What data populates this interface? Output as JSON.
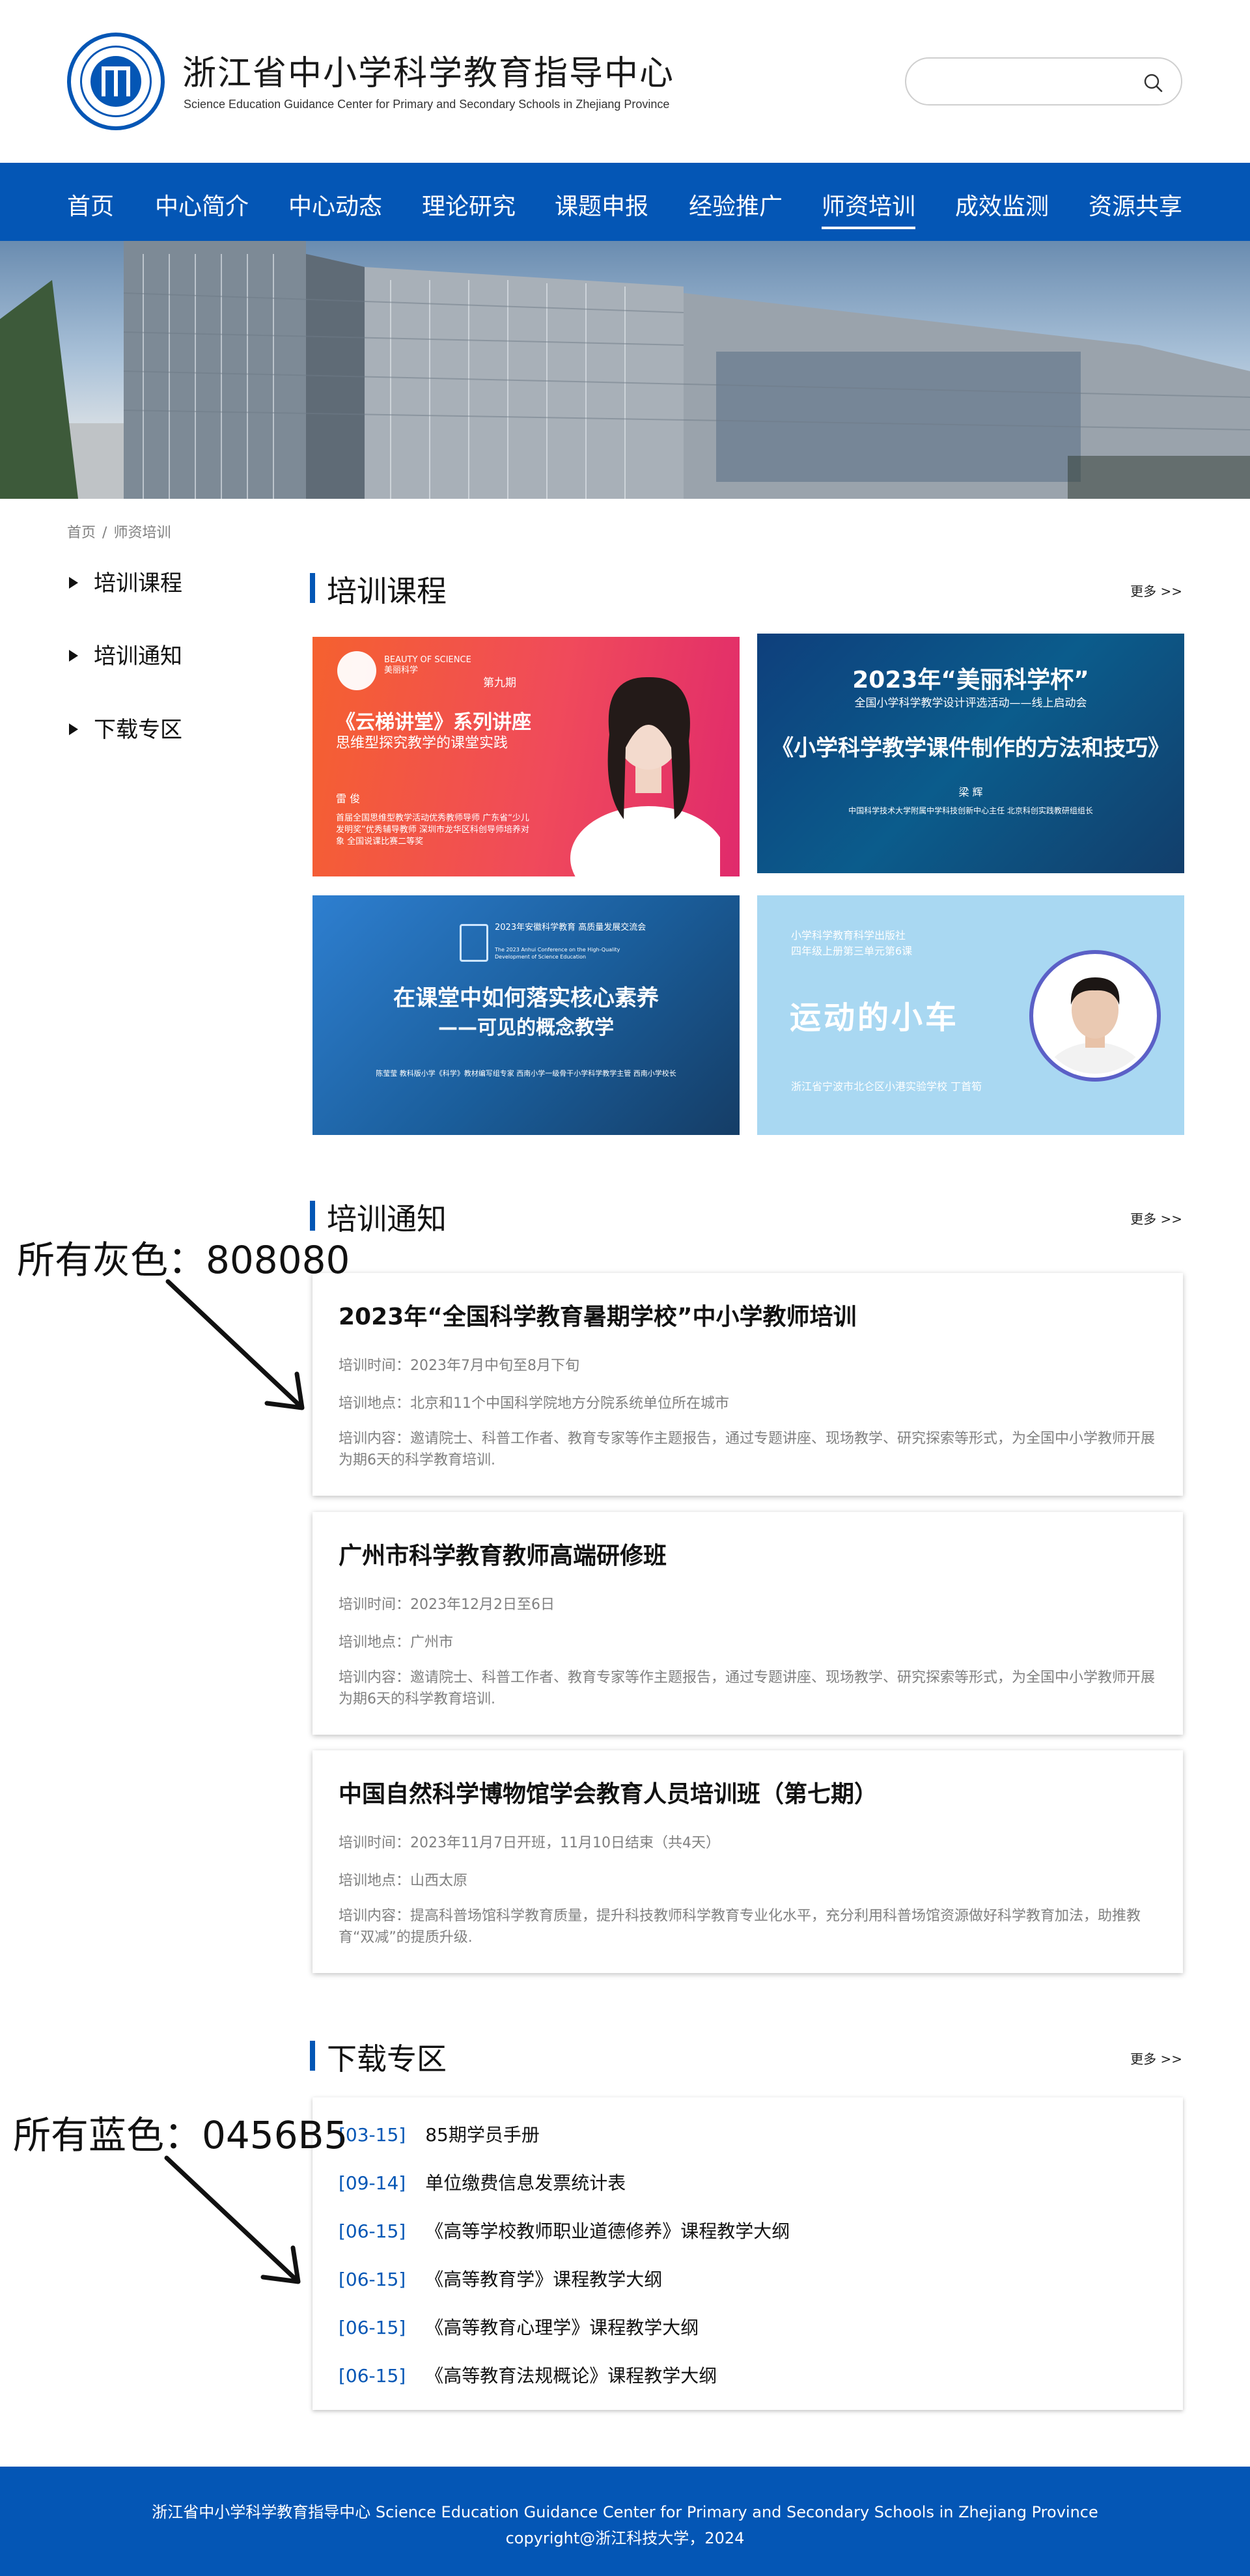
{
  "header": {
    "title": "浙江省中小学科学教育指导中心",
    "subtitle": "Science Education Guidance Center for Primary and Secondary Schools in Zhejiang Province",
    "search_placeholder": ""
  },
  "nav": {
    "items": [
      "首页",
      "中心简介",
      "中心动态",
      "理论研究",
      "课题申报",
      "经验推广",
      "师资培训",
      "成效监测",
      "资源共享"
    ],
    "active": "师资培训"
  },
  "breadcrumb": {
    "home": "首页",
    "sep": "/",
    "current": "师资培训"
  },
  "sidebar": {
    "items": [
      "培训课程",
      "培训通知",
      "下载专区"
    ]
  },
  "sections": {
    "courses": {
      "title": "培训课程",
      "more": "更多 >>"
    },
    "notices": {
      "title": "培训通知",
      "more": "更多 >>"
    },
    "downloads": {
      "title": "下载专区",
      "more": "更多 >>"
    }
  },
  "courses": {
    "c1": {
      "brand": "BEAUTY OF SCIENCE",
      "brand_cn": "美丽科学",
      "issue": "第九期",
      "headline": "《云梯讲堂》系列讲座",
      "sub": "思维型探究教学的课堂实践",
      "name": "雷 俊",
      "bio": "首届全国思维型教学活动优秀教师导师 广东省“少儿发明奖”优秀辅导教师 深圳市龙华区科创导师培养对象 全国说课比赛二等奖"
    },
    "c2": {
      "t1": "2023年“美丽科学杯”",
      "t2": "全国小学科学教学设计评选活动——线上启动会",
      "t3": "《小学科学教学课件制作的方法和技巧》",
      "t4": "梁 辉",
      "t5": "中国科学技术大学附属中学科技创新中心主任 北京科创实践教研组组长"
    },
    "c3": {
      "conf": "2023年安徽科学教育 高质量发展交流会",
      "conf_en": "The 2023 Anhui Conference on the High-Quality Development of Science Education",
      "h1": "在课堂中如何落实核心素养",
      "h2": "——可见的概念教学",
      "meta": "陈莹莹 教科版小学《科学》教材编写组专家 西南小学一级骨干小学科学教学主管 西南小学校长"
    },
    "c4": {
      "p1": "小学科学教育科学出版社",
      "p2": "四年级上册第三单元第6课",
      "title": "运动的小车",
      "foot": "浙江省宁波市北仑区小港实验学校   丁首筍"
    }
  },
  "notices": [
    {
      "title": "2023年“全国科学教育暑期学校”中小学教师培训",
      "time": "培训时间：2023年7月中旬至8月下旬",
      "place": "培训地点：北京和11个中国科学院地方分院系统单位所在城市",
      "content": "培训内容：邀请院士、科普工作者、教育专家等作主题报告，通过专题讲座、现场教学、研究探索等形式，为全国中小学教师开展为期6天的科学教育培训."
    },
    {
      "title": "广州市科学教育教师高端研修班",
      "time": "培训时间：2023年12月2日至6日",
      "place": "培训地点：广州市",
      "content": "培训内容：邀请院士、科普工作者、教育专家等作主题报告，通过专题讲座、现场教学、研究探索等形式，为全国中小学教师开展为期6天的科学教育培训."
    },
    {
      "title": "中国自然科学博物馆学会教育人员培训班（第七期）",
      "time": "培训时间：2023年11月7日开班，11月10日结束（共4天）",
      "place": "培训地点：山西太原",
      "content": "培训内容：提高科普场馆科学教育质量，提升科技教师科学教育专业化水平，充分利用科普场馆资源做好科学教育加法，助推教育“双减”的提质升级."
    }
  ],
  "downloads": [
    {
      "date": "[03-15]",
      "name": "85期学员手册"
    },
    {
      "date": "[09-14]",
      "name": "单位缴费信息发票统计表"
    },
    {
      "date": "[06-15]",
      "name": "《高等学校教师职业道德修养》课程教学大纲"
    },
    {
      "date": "[06-15]",
      "name": "《高等教育学》课程教学大纲"
    },
    {
      "date": "[06-15]",
      "name": "《高等教育心理学》课程教学大纲"
    },
    {
      "date": "[06-15]",
      "name": "《高等教育法规概论》课程教学大纲"
    }
  ],
  "annotations": {
    "gray": "所有灰色：808080",
    "blue": "所有蓝色：0456B5"
  },
  "colors": {
    "brand_blue": "#0456B5",
    "gray_text": "#808080"
  },
  "footer": {
    "line1": "浙江省中小学科学教育指导中心  Science Education Guidance Center for Primary and Secondary Schools in Zhejiang Province",
    "line2": "copyright@浙江科技大学，2024"
  }
}
